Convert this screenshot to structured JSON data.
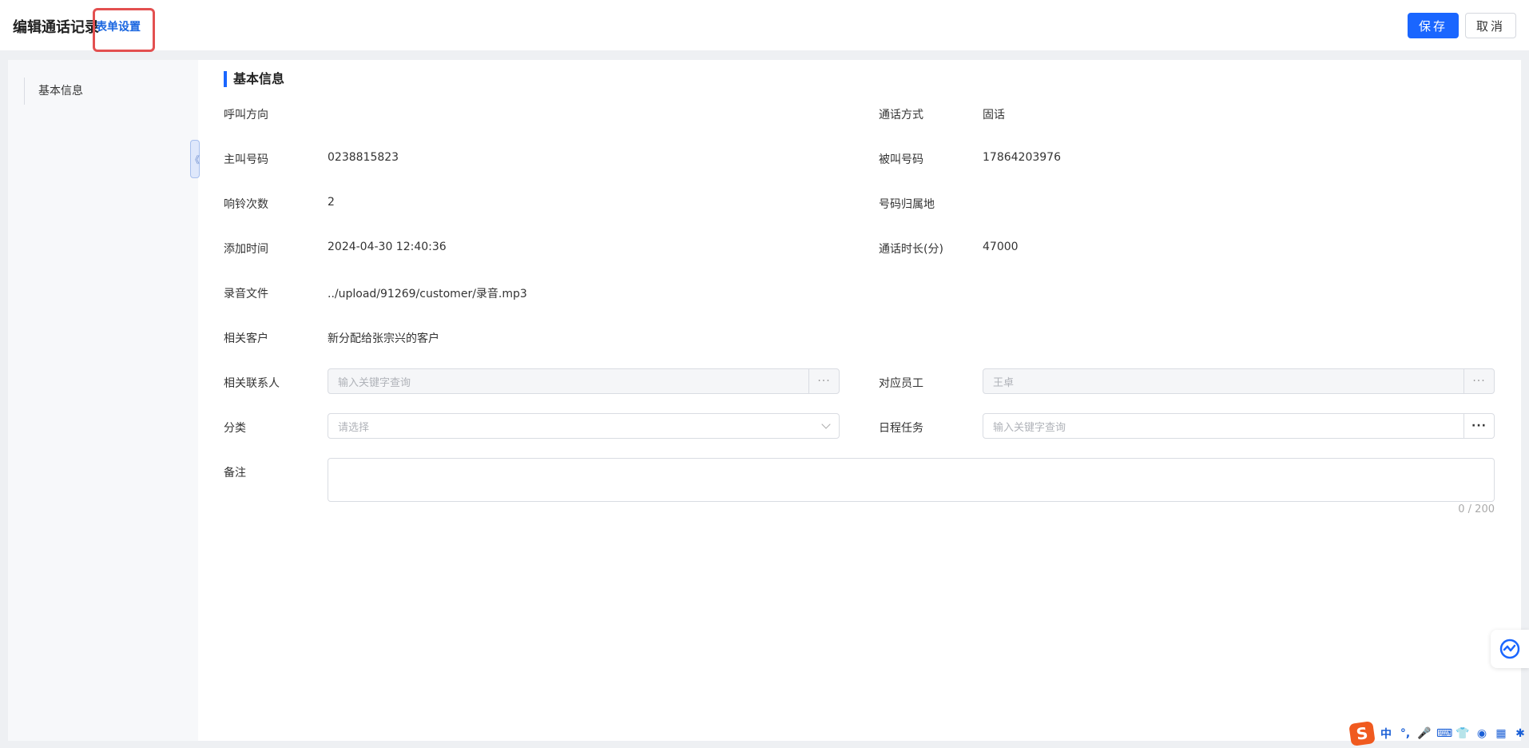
{
  "header": {
    "title": "编辑通话记录",
    "form_settings": "表单设置",
    "save": "保存",
    "cancel": "取消"
  },
  "sidebar": {
    "items": [
      {
        "label": "基本信息"
      }
    ]
  },
  "section": {
    "title": "基本信息"
  },
  "fields": {
    "call_direction": {
      "label": "呼叫方向",
      "value": ""
    },
    "call_method": {
      "label": "通话方式",
      "value": "固话"
    },
    "caller": {
      "label": "主叫号码",
      "value": "0238815823"
    },
    "callee": {
      "label": "被叫号码",
      "value": "17864203976"
    },
    "ring_count": {
      "label": "响铃次数",
      "value": "2"
    },
    "number_location": {
      "label": "号码归属地",
      "value": ""
    },
    "added_time": {
      "label": "添加时间",
      "value": "2024-04-30 12:40:36"
    },
    "duration": {
      "label": "通话时长(分)",
      "value": "47000"
    },
    "recording": {
      "label": "录音文件",
      "value": "../upload/91269/customer/录音.mp3"
    },
    "customer": {
      "label": "相关客户",
      "value": "新分配给张宗兴的客户"
    },
    "contact": {
      "label": "相关联系人",
      "placeholder": "输入关键字查询",
      "button": "···"
    },
    "employee": {
      "label": "对应员工",
      "value": "王卓",
      "button": "···"
    },
    "category": {
      "label": "分类",
      "placeholder": "请选择"
    },
    "schedule": {
      "label": "日程任务",
      "placeholder": "输入关键字查询",
      "button": "···"
    },
    "remark": {
      "label": "备注",
      "counter": "0 / 200"
    }
  },
  "collapse": {
    "glyph": "《"
  },
  "ime": {
    "logo": "S",
    "items": [
      "中",
      "°,",
      "🎤",
      "⌨",
      "👕",
      "◉",
      "▦",
      "✱"
    ]
  },
  "colors": {
    "primary": "#1a66ff",
    "highlight_border": "#e35050",
    "ime_logo": "#f05a1f"
  }
}
